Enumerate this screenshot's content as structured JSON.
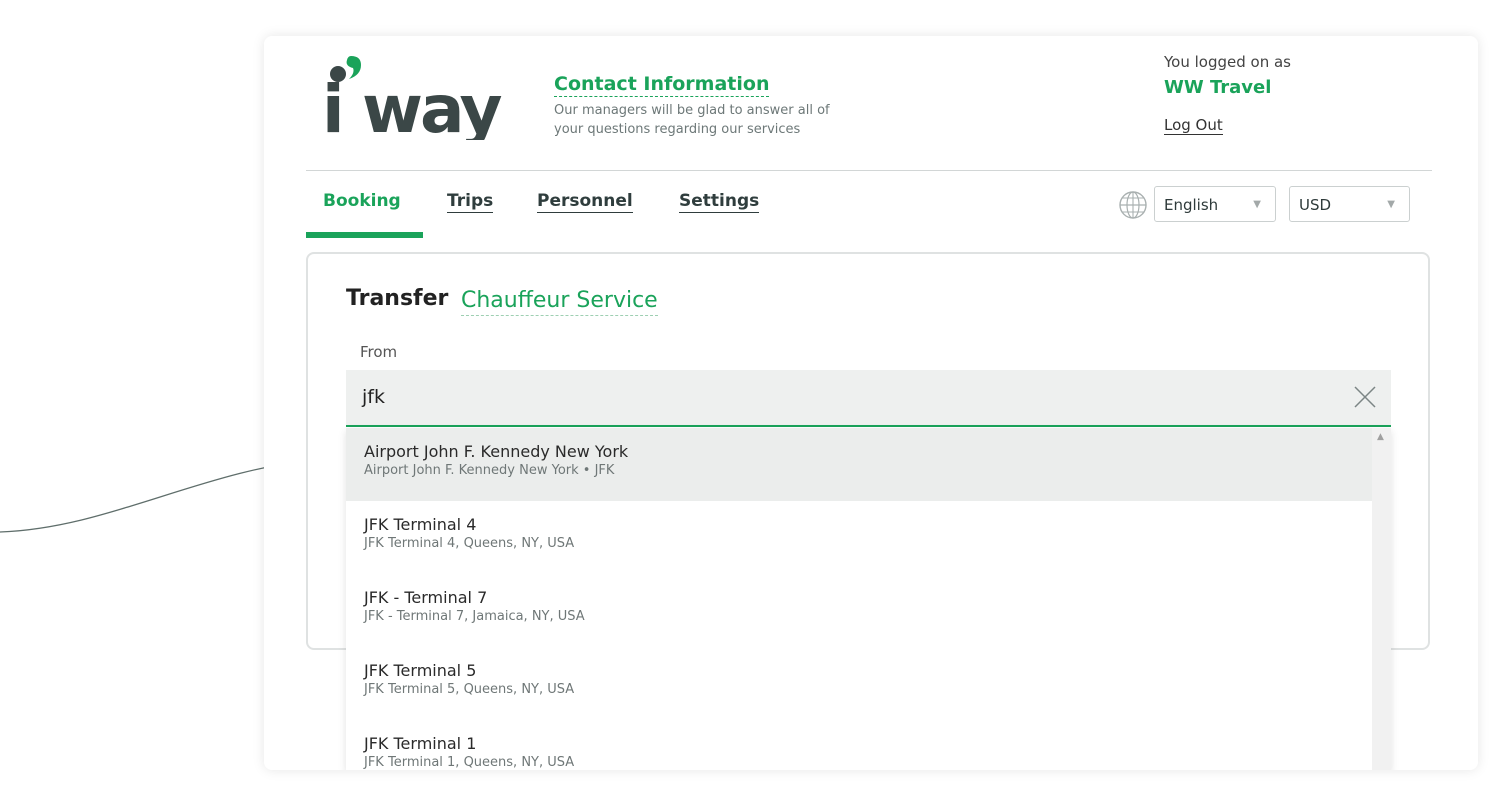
{
  "header": {
    "logo_text": "i'way",
    "contact": {
      "title": "Contact Information",
      "description": "Our managers will be glad to answer all of your questions regarding our services"
    },
    "user": {
      "prefix": "You logged on as",
      "name": "WW Travel",
      "logout_label": "Log Out"
    }
  },
  "nav": {
    "tabs": [
      {
        "label": "Booking",
        "active": true
      },
      {
        "label": "Trips",
        "active": false
      },
      {
        "label": "Personnel",
        "active": false
      },
      {
        "label": "Settings",
        "active": false
      }
    ],
    "language": "English",
    "currency": "USD"
  },
  "form": {
    "title": "Transfer",
    "service_link": "Chauffeur Service",
    "from_label": "From",
    "from_value": "jfk"
  },
  "suggestions": [
    {
      "main": "Airport John F. Kennedy New York",
      "sub": "Airport John F. Kennedy New York • JFK",
      "highlighted": true
    },
    {
      "main": "JFK Terminal 4",
      "sub": "JFK Terminal 4, Queens, NY, USA",
      "highlighted": false
    },
    {
      "main": "JFK - Terminal 7",
      "sub": "JFK - Terminal 7, Jamaica, NY, USA",
      "highlighted": false
    },
    {
      "main": "JFK Terminal 5",
      "sub": "JFK Terminal 5, Queens, NY, USA",
      "highlighted": false
    },
    {
      "main": "JFK Terminal 1",
      "sub": "JFK Terminal 1, Queens, NY, USA",
      "highlighted": false
    }
  ],
  "colors": {
    "accent": "#1aa35a",
    "dark": "#3b4747",
    "highlight_bg": "#ebedec"
  }
}
